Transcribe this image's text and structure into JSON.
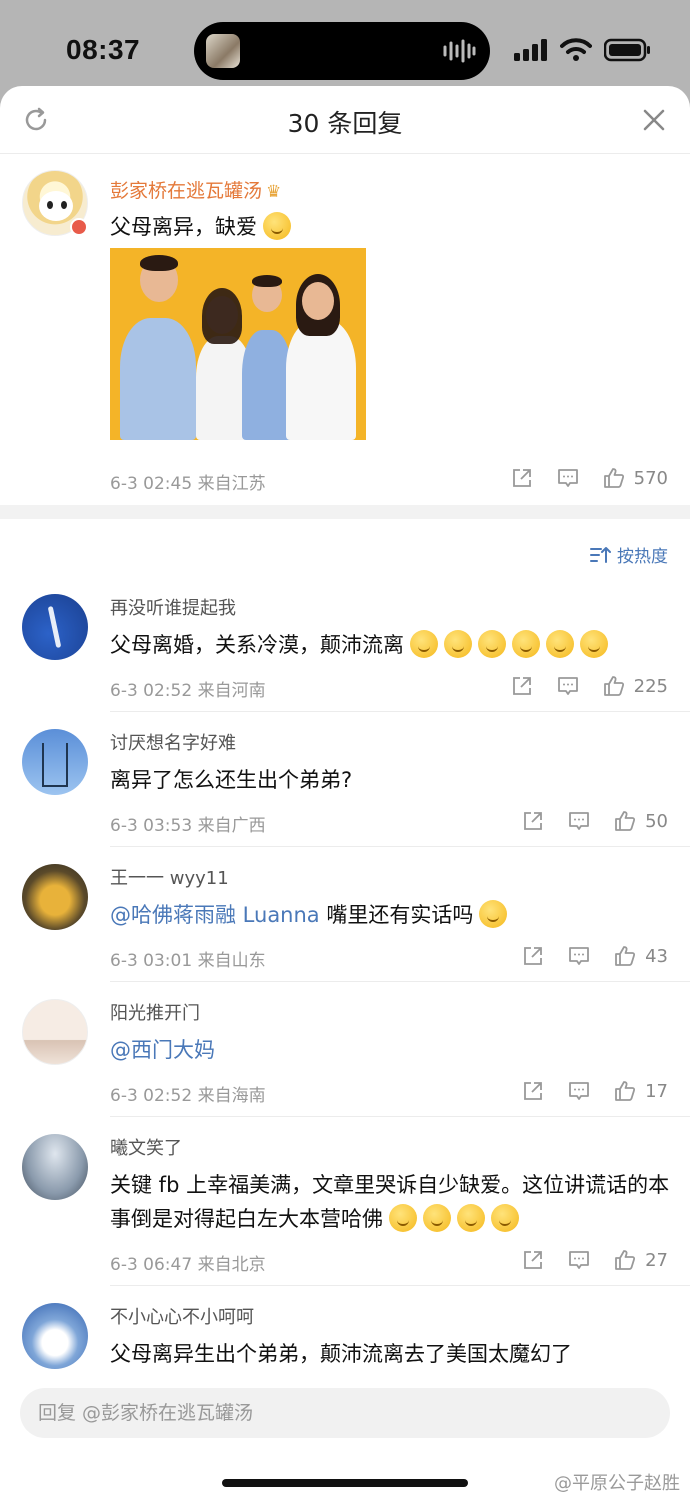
{
  "status_bar": {
    "time": "08:37"
  },
  "header": {
    "title": "30 条回复"
  },
  "main_comment": {
    "username": "彭家桥在逃瓦罐汤",
    "text": "父母离异，缺爱",
    "meta": "6-3 02:45  来自江苏",
    "likes": "570"
  },
  "sort": {
    "label": "按热度"
  },
  "replies": [
    {
      "username": "再没听谁提起我",
      "text": "父母离婚，关系冷漠，颠沛流离",
      "emoji_count": 6,
      "meta": "6-3 02:52  来自河南",
      "likes": "225"
    },
    {
      "username": "讨厌想名字好难",
      "text": "离异了怎么还生出个弟弟?",
      "meta": "6-3 03:53  来自广西",
      "likes": "50"
    },
    {
      "username": "王一一 wyy11",
      "mention": "@哈佛蒋雨融 Luanna",
      "text": " 嘴里还有实话吗",
      "meta": "6-3 03:01  来自山东",
      "likes": "43"
    },
    {
      "username": "阳光推开门",
      "mention": "@西门大妈",
      "meta": "6-3 02:52  来自海南",
      "likes": "17"
    },
    {
      "username": "曦文笑了",
      "text": "关键 fb 上幸福美满，文章里哭诉自少缺爱。这位讲谎话的本事倒是对得起白左大本营哈佛",
      "meta": "6-3 06:47  来自北京",
      "likes": "27"
    },
    {
      "username": "不小心心不小呵呵",
      "text": "父母离异生出个弟弟，颠沛流离去了美国太魔幻了"
    }
  ],
  "reply_input": {
    "placeholder": "回复 @彭家桥在逃瓦罐汤"
  },
  "watermark": "@平原公子赵胜",
  "colors": {
    "accent_blue": "#4a78b8",
    "username_orange": "#e4793a"
  }
}
